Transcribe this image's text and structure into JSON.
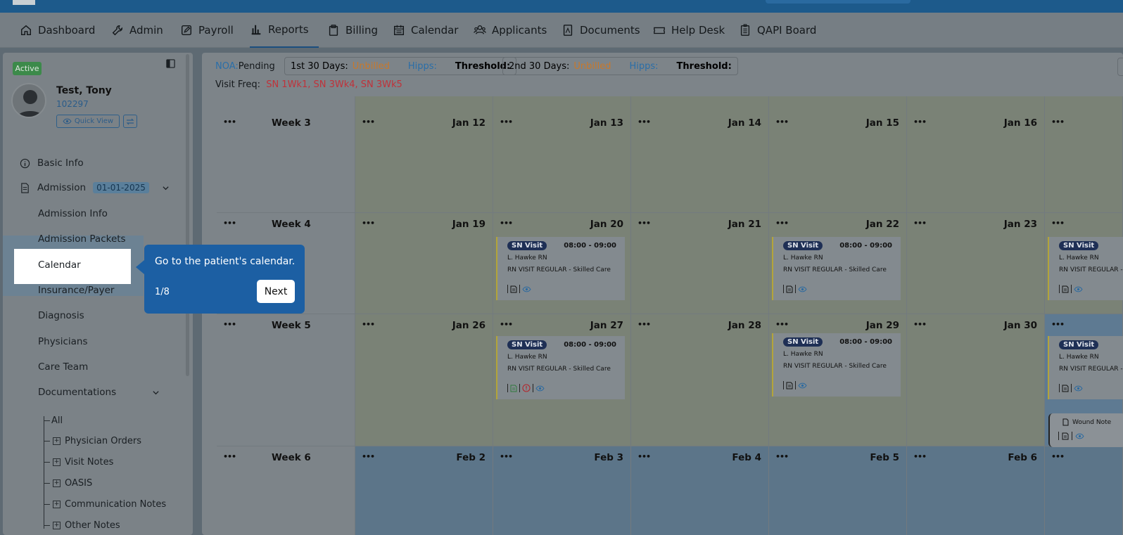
{
  "nav": {
    "items": [
      {
        "label": "Dashboard",
        "icon": "home-icon"
      },
      {
        "label": "Admin",
        "icon": "wrench-icon"
      },
      {
        "label": "Payroll",
        "icon": "edit-icon"
      },
      {
        "label": "Reports",
        "icon": "bar-chart-icon"
      },
      {
        "label": "Billing",
        "icon": "clipboard-icon"
      },
      {
        "label": "Calendar",
        "icon": "calendar-icon"
      },
      {
        "label": "Applicants",
        "icon": "users-icon"
      },
      {
        "label": "Documents",
        "icon": "pdf-icon"
      },
      {
        "label": "Help Desk",
        "icon": "ticket-icon"
      },
      {
        "label": "QAPI Board",
        "icon": "checklist-icon"
      }
    ],
    "active": "Reports"
  },
  "patient": {
    "status": "Active",
    "name": "Test, Tony",
    "id": "102297",
    "quick_view": "Quick View"
  },
  "sidebar": {
    "basic_info": "Basic Info",
    "admission": "Admission",
    "admission_date": "01-01-2025",
    "sub": [
      "Admission Info",
      "Admission Packets",
      "Calendar",
      "Insurance/Payer",
      "Diagnosis",
      "Physicians",
      "Care Team"
    ],
    "documentations": "Documentations",
    "tree": [
      "All",
      "Physician Orders",
      "Visit Notes",
      "OASIS",
      "Communication Notes",
      "Other Notes"
    ]
  },
  "header": {
    "noa_label": "NOA:",
    "noa_value": "Pending",
    "first30_label": "1st 30 Days:",
    "first30_value": "Unbilled",
    "hipps_label": "Hipps:",
    "threshold_label": "Threshold:",
    "second30_label": "2nd 30 Days:",
    "second30_value": "Unbilled",
    "visit_freq_label": "Visit Freq:",
    "visit_freq_value": "SN 1Wk1, SN 3Wk4, SN 3Wk5"
  },
  "calendar": {
    "dots": "•••",
    "weeks": [
      {
        "label": "Week 3",
        "days": [
          "Jan 12",
          "Jan 13",
          "Jan 14",
          "Jan 15",
          "Jan 16",
          ""
        ]
      },
      {
        "label": "Week 4",
        "days": [
          "Jan 19",
          "Jan 20",
          "Jan 21",
          "Jan 22",
          "Jan 23",
          ""
        ]
      },
      {
        "label": "Week 5",
        "days": [
          "Jan 26",
          "Jan 27",
          "Jan 28",
          "Jan 29",
          "Jan 30",
          ""
        ]
      },
      {
        "label": "Week 6",
        "days": [
          "Feb 2",
          "Feb 3",
          "Feb 4",
          "Feb 5",
          "Feb 6",
          ""
        ]
      }
    ],
    "visit": {
      "tag": "SN Visit",
      "time": "08:00 - 09:00",
      "nurse": "L. Hawke RN",
      "desc": "RN VISIT REGULAR - Skilled Care",
      "desc_cut": "RN VISIT REGULAR -"
    },
    "wound_note": "Wound Note"
  },
  "tooltip": {
    "text": "Go to the patient's calendar.",
    "step": "1/8",
    "next": "Next"
  }
}
